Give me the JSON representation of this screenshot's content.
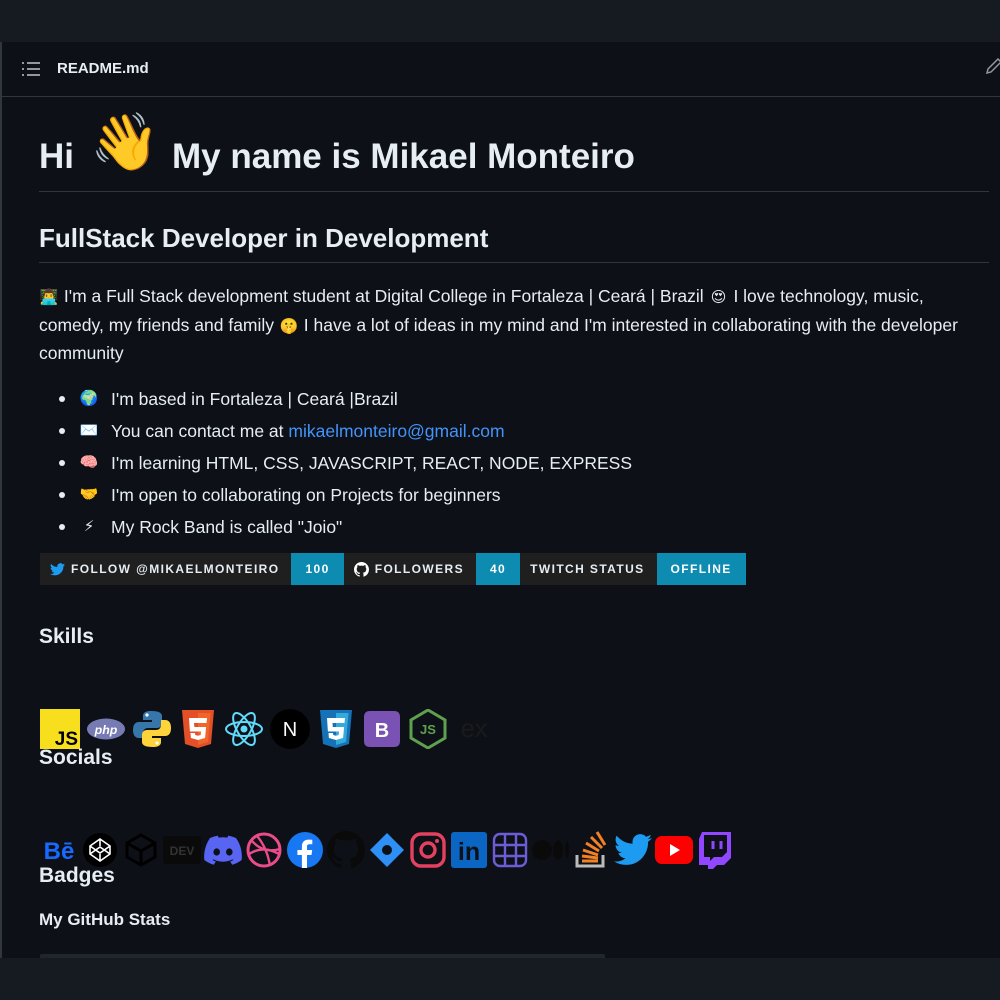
{
  "readme": {
    "filename": "README.md"
  },
  "intro": {
    "greeting_hi": "Hi",
    "greeting_emoji": "👋",
    "greeting_name": "My name is Mikael Monteiro",
    "subtitle": "FullStack Developer in Development",
    "paragraph": {
      "emoji_1": "👨‍💻",
      "part_1": "I'm a Full Stack development student at Digital College in Fortaleza | Ceará | Brazil",
      "emoji_2": "😍",
      "part_2": "I love technology, music, comedy, my friends and family",
      "emoji_3": "🤫",
      "part_3": "I have a lot of ideas in my mind and I'm interested in collaborating with the developer community"
    }
  },
  "facts": [
    {
      "emoji": "🌍",
      "text": "I'm based in Fortaleza | Ceará |Brazil"
    },
    {
      "emoji": "✉️",
      "text": "You can contact me at ",
      "link": "mikaelmonteiro@gmail.com"
    },
    {
      "emoji": "🧠",
      "text": "I'm learning HTML, CSS, JAVASCRIPT, REACT, NODE, EXPRESS"
    },
    {
      "emoji": "🤝",
      "text": "I'm open to collaborating on Projects for beginners"
    },
    {
      "emoji": "⚡",
      "text": "My Rock Band is called \"Joio\""
    }
  ],
  "badges": [
    {
      "label": "FOLLOW @MIKAELMONTEIRO",
      "value": "100",
      "icon": "twitter-icon"
    },
    {
      "label": "FOLLOWERS",
      "value": "40",
      "icon": "github-icon"
    },
    {
      "label": "TWITCH STATUS",
      "value": "OFFLINE",
      "icon": ""
    }
  ],
  "colors": {
    "badge_value_bg": "#0e8bb0",
    "link": "#4493f8",
    "page_bg": "#0d1117",
    "border": "#30363d"
  },
  "sections": {
    "skills": "Skills",
    "socials": "Socials",
    "badges": "Badges",
    "github_stats": "My GitHub Stats"
  },
  "skills": [
    "javascript-icon",
    "php-icon",
    "python-icon",
    "html5-icon",
    "react-icon",
    "nextjs-icon",
    "css3-icon",
    "bootstrap-icon",
    "nodejs-icon",
    "express-icon"
  ],
  "socials": [
    "behance-icon",
    "codepen-icon",
    "codesandbox-icon",
    "devto-icon",
    "discord-icon",
    "dribbble-icon",
    "facebook-icon",
    "github-icon",
    "kaggle-icon",
    "instagram-icon",
    "linkedin-icon",
    "notion-icon",
    "medium-icon",
    "stackoverflow-icon",
    "twitter-icon",
    "youtube-icon",
    "twitch-icon"
  ],
  "icon_text": {
    "js": "JS",
    "php": "php",
    "next": "N",
    "bootstrap": "B",
    "express": "ex",
    "behance": "Bē",
    "dev": "DEV",
    "linkedin": "in"
  }
}
